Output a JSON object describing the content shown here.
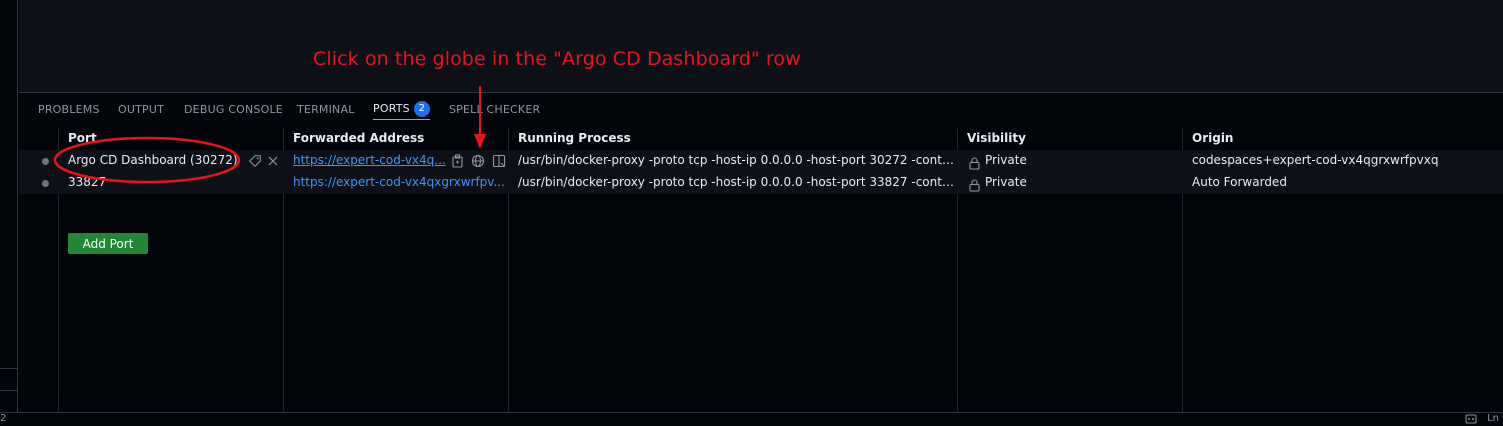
{
  "annotation": "Click on the globe in the \"Argo CD Dashboard\" row",
  "tabs": [
    {
      "label": "PROBLEMS"
    },
    {
      "label": "OUTPUT"
    },
    {
      "label": "DEBUG CONSOLE"
    },
    {
      "label": "TERMINAL"
    },
    {
      "label": "PORTS",
      "badge": "2",
      "active": true
    },
    {
      "label": "SPELL CHECKER"
    }
  ],
  "columns": [
    "Port",
    "Forwarded Address",
    "Running Process",
    "Visibility",
    "Origin"
  ],
  "rows": [
    {
      "port": "Argo CD Dashboard (30272)",
      "address": "https://expert-cod-vx4q...",
      "process": "/usr/bin/docker-proxy -proto tcp -host-ip 0.0.0.0 -host-port 30272 -conta...",
      "visibility": "Private",
      "origin": "codespaces+expert-cod-vx4qgrxwrfpvxq"
    },
    {
      "port": "33827",
      "address": "https://expert-cod-vx4qxgrxwrfpv...",
      "process": "/usr/bin/docker-proxy -proto tcp -host-ip 0.0.0.0 -host-port 33827 -conta...",
      "visibility": "Private",
      "origin": "Auto Forwarded"
    }
  ],
  "add_port_label": "Add Port",
  "status": {
    "left": "2",
    "right": "Ln"
  },
  "colors": {
    "annotation": "#e8141a",
    "accent": "#1f6feb",
    "add_port": "#238636",
    "link": "#4493f8"
  },
  "icons": [
    "label-edit-icon",
    "close-icon",
    "copy-icon",
    "globe-icon",
    "preview-icon",
    "lock-icon",
    "remote-icon"
  ]
}
